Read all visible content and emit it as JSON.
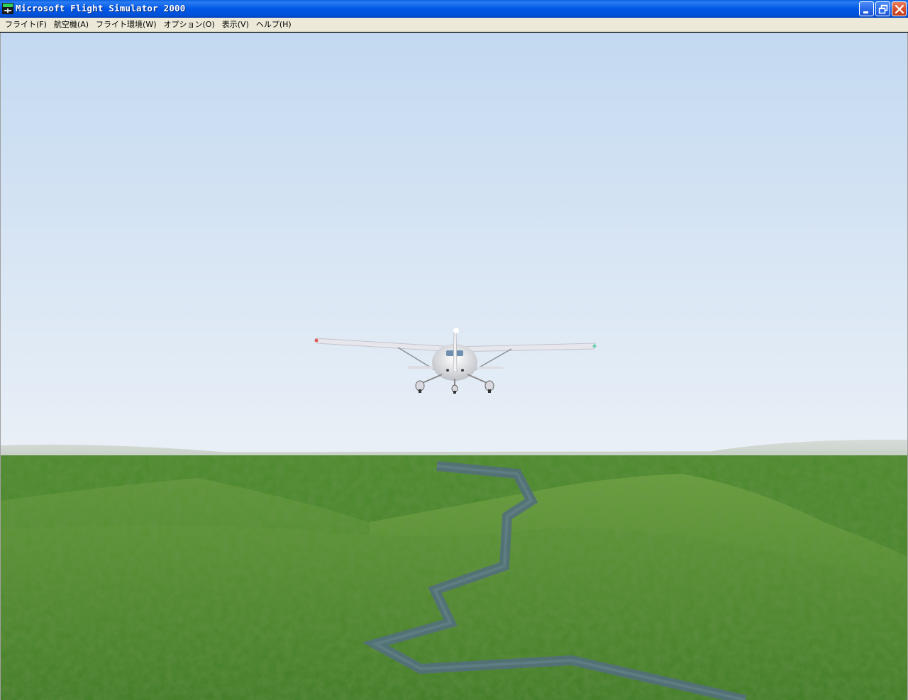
{
  "window": {
    "title": "Microsoft Flight Simulator 2000",
    "icon": "fs2000-app-icon",
    "controls": {
      "minimize": "minimize-icon",
      "restore": "restore-icon",
      "close": "close-icon"
    }
  },
  "menu": {
    "items": [
      {
        "label": "フライト(F)"
      },
      {
        "label": "航空機(A)"
      },
      {
        "label": "フライト環境(W)"
      },
      {
        "label": "オプション(O)"
      },
      {
        "label": "表示(V)"
      },
      {
        "label": "ヘルプ(H)"
      }
    ]
  },
  "scene": {
    "description_icon": "cessna-aircraft-rear-view",
    "colors": {
      "sky_top": "#c6dcf2",
      "sky_horizon": "#e6eff8",
      "grass_dark": "#3f7a26",
      "grass_light": "#6b9e3a",
      "river": "#52707a",
      "aircraft": "#e8e8ec"
    }
  }
}
